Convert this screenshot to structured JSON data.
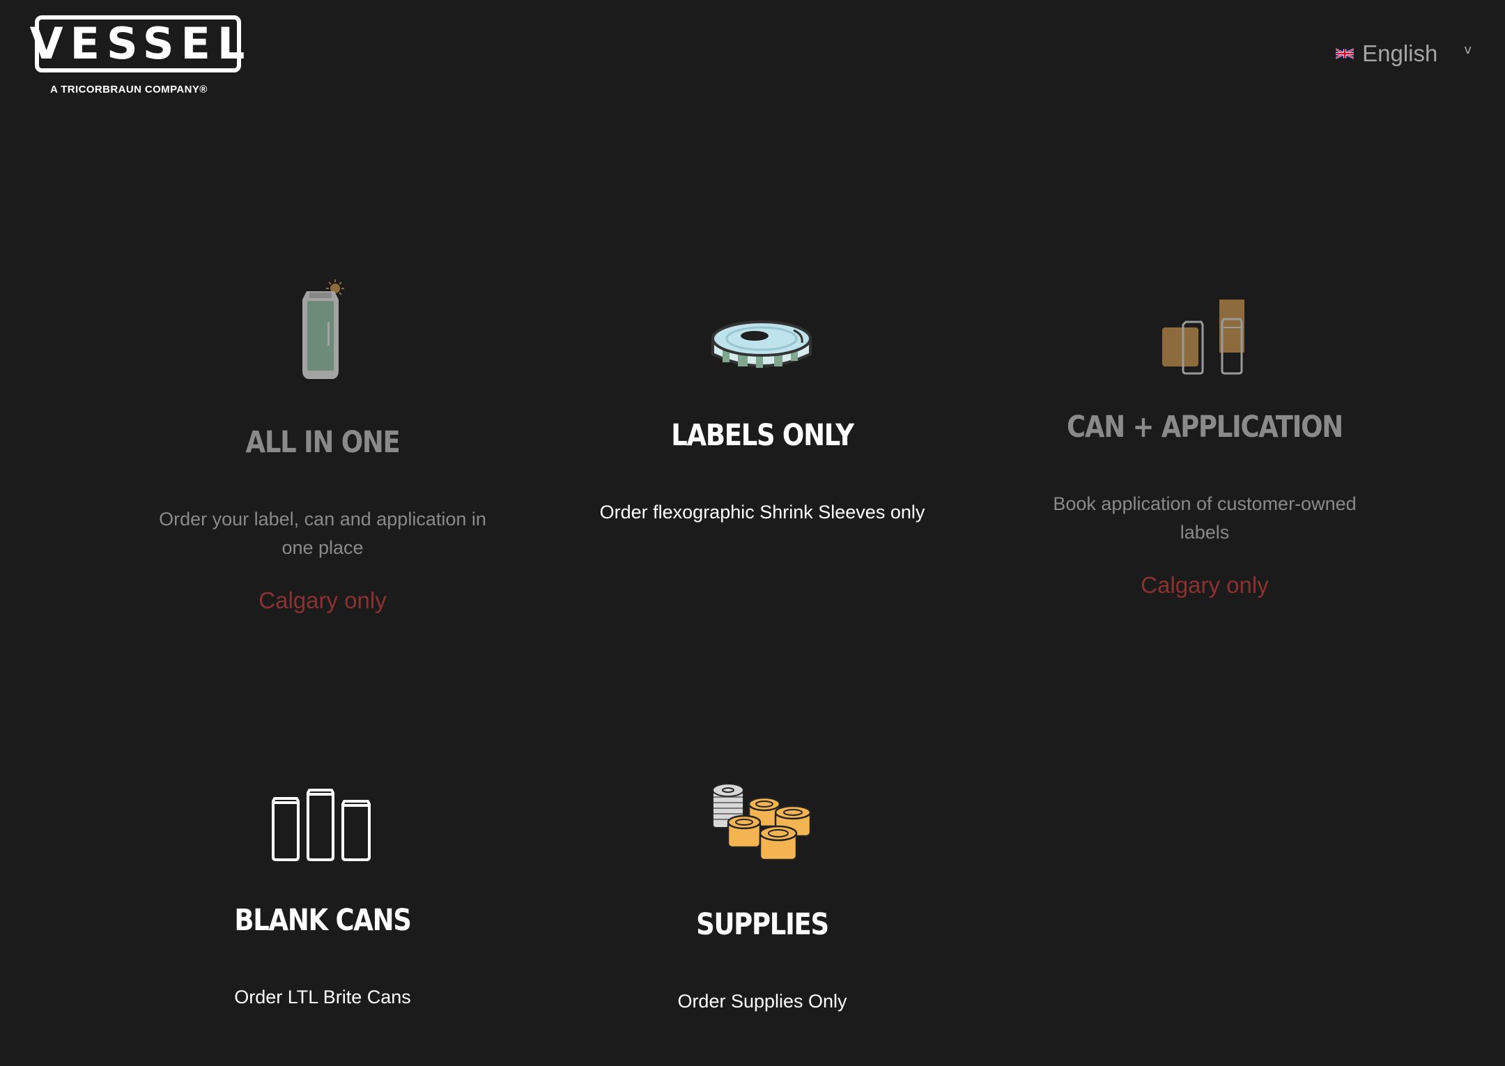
{
  "header": {
    "logo_text": "VESSEL",
    "logo_tagline": "A TRICORBRAUN COMPANY®",
    "language": {
      "flag_icon": "uk-flag-icon",
      "selected": "English",
      "dropdown_icon": "chevron-down-icon"
    }
  },
  "cards": [
    {
      "id": "all-in-one",
      "icon": "can-with-spark-icon",
      "title": "ALL IN ONE",
      "description": "Order your label, can and application in one place",
      "note": "Calgary only",
      "state": "disabled"
    },
    {
      "id": "labels-only",
      "icon": "label-roll-icon",
      "title": "LABELS ONLY",
      "description": "Order flexographic Shrink Sleeves only",
      "state": "enabled"
    },
    {
      "id": "can-application",
      "icon": "can-and-sleeves-icon",
      "title": "CAN + APPLICATION",
      "description": "Book application of customer-owned labels",
      "note": "Calgary only",
      "state": "disabled"
    },
    {
      "id": "blank-cans",
      "icon": "blank-cans-icon",
      "title": "BLANK CANS",
      "description": "Order LTL Brite Cans",
      "state": "enabled"
    },
    {
      "id": "supplies",
      "icon": "supplies-lids-icon",
      "title": "SUPPLIES",
      "description": "Order Supplies Only",
      "state": "enabled"
    }
  ],
  "colors": {
    "background": "#1b1b1b",
    "disabled_text": "#8a8a8a",
    "note_red": "#8b3230",
    "can_green": "#6d8b78",
    "label_blue": "#bfe3ec",
    "tan": "#8e6b3d",
    "gold": "#f4b452"
  }
}
